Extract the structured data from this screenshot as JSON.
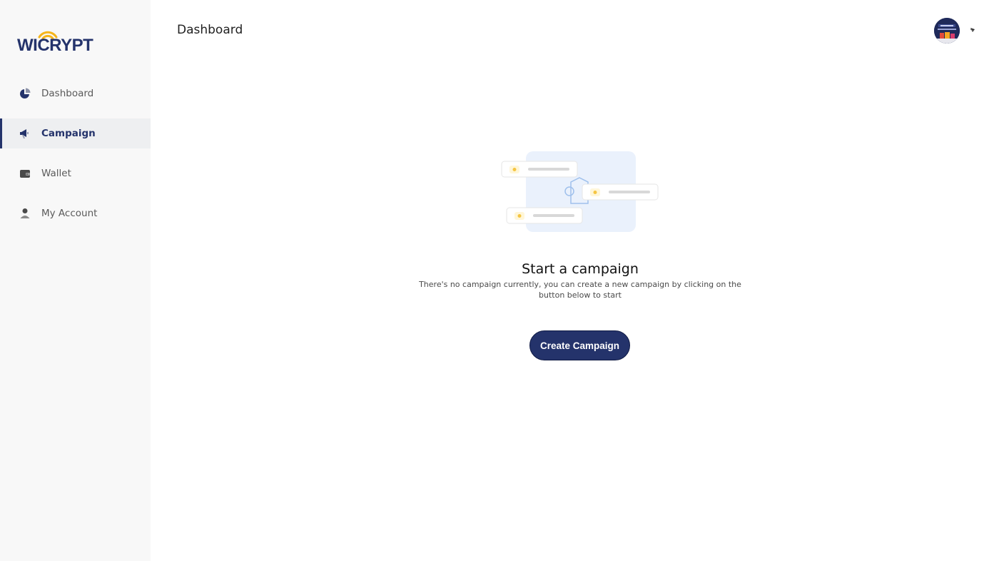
{
  "brand": {
    "logo_text": "WICRYPT",
    "primary_color": "#24336b",
    "wifi_color": "#f5b51b"
  },
  "sidebar": {
    "items": [
      {
        "label": "Dashboard",
        "icon": "pie-chart-icon",
        "active": false
      },
      {
        "label": "Campaign",
        "icon": "megaphone-icon",
        "active": true
      },
      {
        "label": "Wallet",
        "icon": "wallet-icon",
        "active": false
      },
      {
        "label": "My Account",
        "icon": "user-icon",
        "active": false
      }
    ]
  },
  "header": {
    "title": "Dashboard",
    "avatar_icon": "user-avatar",
    "menu_icon": "chevron-down-icon"
  },
  "empty_state": {
    "illustration_icon": "campaign-empty-illustration",
    "title": "Start a campaign",
    "description": "There's no campaign currently, you can create a new campaign by clicking on the button below to start",
    "button_label": "Create Campaign"
  }
}
